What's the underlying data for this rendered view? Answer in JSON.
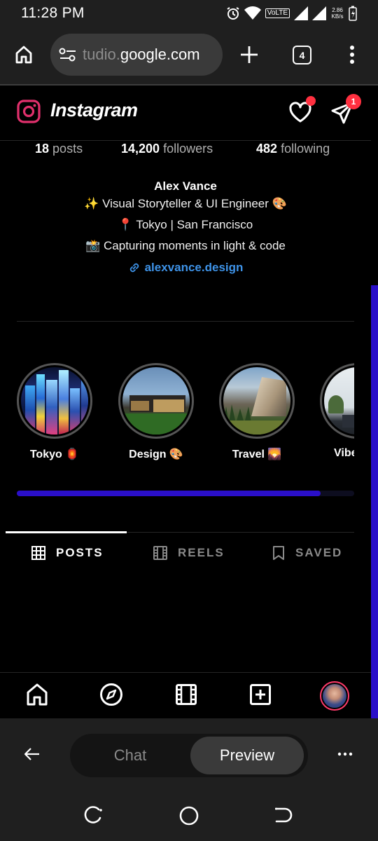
{
  "status_bar": {
    "time": "11:28 PM",
    "volte": "VoLTE",
    "net_speed_value": "2.86",
    "net_speed_unit": "KB/s"
  },
  "browser": {
    "url_faded": "tudio.",
    "url_main": "google.com",
    "tab_count": "4"
  },
  "instagram": {
    "title": "Instagram",
    "message_badge": "1",
    "stats": {
      "posts_count": "18",
      "posts_label": "posts",
      "followers_count": "14,200",
      "followers_label": "followers",
      "following_count": "482",
      "following_label": "following"
    },
    "bio": {
      "name": "Alex Vance",
      "line1": "✨ Visual Storyteller & UI Engineer 🎨",
      "line2": "📍 Tokyo | San Francisco",
      "line3": "📸 Capturing moments in light & code",
      "link": "alexvance.design"
    },
    "highlights": [
      {
        "label": "Tokyo 🏮"
      },
      {
        "label": "Design 🎨"
      },
      {
        "label": "Travel 🌄"
      },
      {
        "label": "Vibe"
      }
    ],
    "highlights_scroll_fraction": 0.9,
    "tabs": [
      {
        "label": "POSTS",
        "active": true
      },
      {
        "label": "REELS",
        "active": false
      },
      {
        "label": "SAVED",
        "active": false
      }
    ],
    "accent_color": "#2a0fc9",
    "notification_color": "#ff3040",
    "link_color": "#3e93e8"
  },
  "app_toolbar": {
    "chat_label": "Chat",
    "preview_label": "Preview"
  }
}
